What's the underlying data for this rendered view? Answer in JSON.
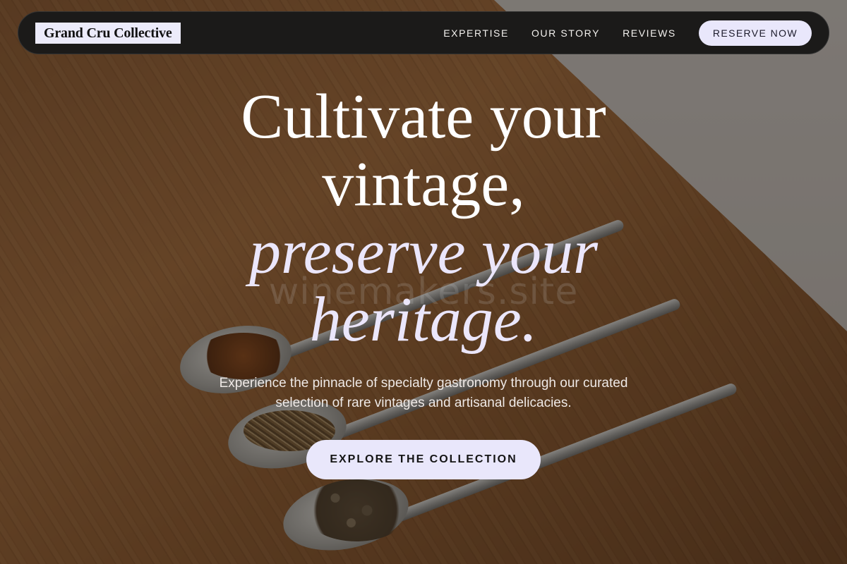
{
  "nav": {
    "brand": "Grand Cru Collective",
    "links": [
      "EXPERTISE",
      "OUR STORY",
      "REVIEWS"
    ],
    "cta": "RESERVE NOW"
  },
  "hero": {
    "headline_line1": "Cultivate your",
    "headline_line2": "vintage,",
    "headline_line3": "preserve your",
    "headline_line4": "heritage.",
    "subtitle_line1": "Experience the pinnacle of specialty gastronomy through our curated",
    "subtitle_line2": "selection of rare vintages and artisanal delicacies.",
    "button": "EXPLORE THE COLLECTION",
    "watermark": "winemakers.site"
  },
  "colors": {
    "navbar_bg": "#1b1a19",
    "accent_lavender": "#e9e7fb",
    "overlay": "rgba(20,14,10,0.42)"
  },
  "background_image": "wooden table with spoons of spices"
}
